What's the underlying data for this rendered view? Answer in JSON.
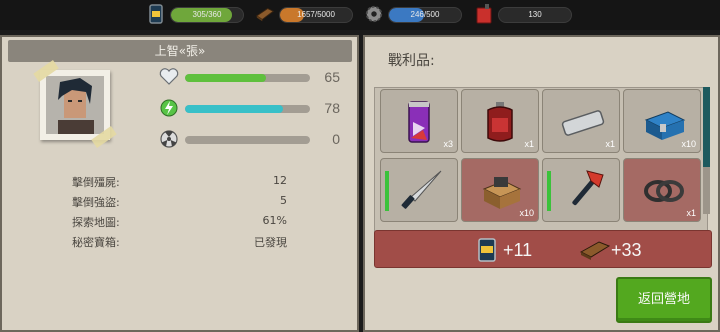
{
  "topbar": {
    "resources": [
      {
        "name": "food",
        "value": "305/360",
        "fraction": 0.85,
        "color": "#6fa73b",
        "icon": "can-icon"
      },
      {
        "name": "material",
        "value": "1657/5000",
        "fraction": 0.33,
        "color": "#c9782b",
        "icon": "wood-plank-icon"
      },
      {
        "name": "tech",
        "value": "246/500",
        "fraction": 0.49,
        "color": "#3b79c2",
        "icon": "gear-icon"
      },
      {
        "name": "fuel",
        "value": "130",
        "icon": "fuel-can-icon"
      }
    ]
  },
  "character": {
    "name": "上智«張»",
    "stats": [
      {
        "name": "health",
        "icon": "heart-icon",
        "value": "65",
        "fraction": 0.65,
        "color": "#5fc03d"
      },
      {
        "name": "energy",
        "icon": "lightning-icon",
        "value": "78",
        "fraction": 0.78,
        "color": "#38c0c8"
      },
      {
        "name": "radiation",
        "icon": "radiation-icon",
        "value": "0",
        "fraction": 0.0,
        "color": "#8b8b8b"
      }
    ],
    "records": [
      {
        "label": "擊倒殭屍:",
        "value": "12"
      },
      {
        "label": "擊倒強盜:",
        "value": "5"
      },
      {
        "label": "探索地圖:",
        "value": "61%"
      },
      {
        "label": "秘密寶箱:",
        "value": "已發現"
      }
    ]
  },
  "loot": {
    "title": "戰利品:",
    "items": [
      {
        "name": "energy-drink",
        "qty": "x3",
        "icon": "energy-drink-icon"
      },
      {
        "name": "blood-bag",
        "qty": "x1",
        "icon": "blood-bag-icon"
      },
      {
        "name": "metal-pipe",
        "qty": "x1",
        "icon": "pipe-icon"
      },
      {
        "name": "supply-crate",
        "qty": "x10",
        "icon": "crate-icon"
      },
      {
        "name": "knife",
        "qty": "",
        "icon": "knife-icon",
        "durability": true
      },
      {
        "name": "wood-box",
        "qty": "x10",
        "icon": "wood-box-icon",
        "highlight": true
      },
      {
        "name": "fire-axe",
        "qty": "",
        "icon": "axe-icon",
        "durability": true
      },
      {
        "name": "rope",
        "qty": "x1",
        "icon": "rope-icon",
        "highlight": true
      }
    ],
    "rewards": [
      {
        "icon": "can-icon",
        "value": "+11"
      },
      {
        "icon": "wood-plank-icon",
        "value": "+33"
      }
    ]
  },
  "return_button": "返回營地"
}
